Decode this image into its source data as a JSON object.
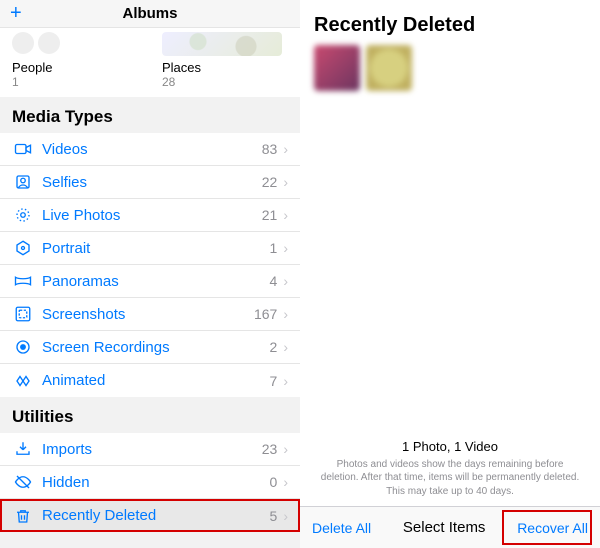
{
  "left": {
    "navbar": {
      "title": "Albums"
    },
    "smart": {
      "people": {
        "name": "People",
        "count": "1"
      },
      "places": {
        "name": "Places",
        "count": "28"
      }
    },
    "sections": {
      "mediaTypes": {
        "header": "Media Types",
        "items": [
          {
            "icon": "videos",
            "label": "Videos",
            "count": "83"
          },
          {
            "icon": "selfies",
            "label": "Selfies",
            "count": "22"
          },
          {
            "icon": "live",
            "label": "Live Photos",
            "count": "21"
          },
          {
            "icon": "portrait",
            "label": "Portrait",
            "count": "1"
          },
          {
            "icon": "pano",
            "label": "Panoramas",
            "count": "4"
          },
          {
            "icon": "screenshots",
            "label": "Screenshots",
            "count": "167"
          },
          {
            "icon": "screenrec",
            "label": "Screen Recordings",
            "count": "2"
          },
          {
            "icon": "animated",
            "label": "Animated",
            "count": "7"
          }
        ]
      },
      "utilities": {
        "header": "Utilities",
        "items": [
          {
            "icon": "imports",
            "label": "Imports",
            "count": "23"
          },
          {
            "icon": "hidden",
            "label": "Hidden",
            "count": "0"
          },
          {
            "icon": "trash",
            "label": "Recently Deleted",
            "count": "5",
            "highlighted": true
          }
        ]
      }
    }
  },
  "right": {
    "title": "Recently Deleted",
    "summary": "1 Photo, 1 Video",
    "hint": "Photos and videos show the days remaining before deletion. After that time, items will be permanently deleted. This may take up to 40 days.",
    "toolbar": {
      "delete": "Delete All",
      "select": "Select Items",
      "recover": "Recover All"
    }
  }
}
